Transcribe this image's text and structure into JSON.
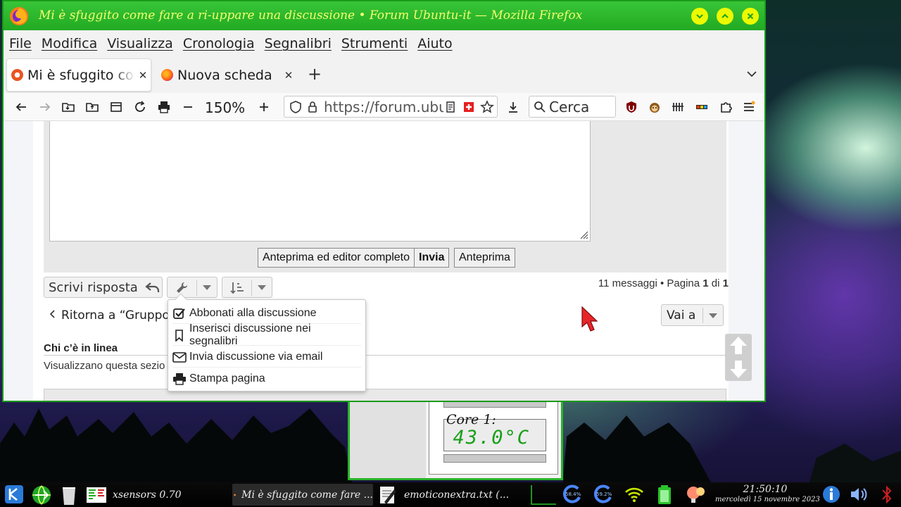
{
  "window": {
    "title": "Mi è sfuggito come fare a ri-uppare una discussione • Forum Ubuntu-it — Mozilla Firefox"
  },
  "menubar": [
    "File",
    "Modifica",
    "Visualizza",
    "Cronologia",
    "Segnalibri",
    "Strumenti",
    "Aiuto"
  ],
  "tabs": [
    {
      "title": "Mi è sfuggito come fare a ri-uppare una discussione",
      "active": true
    },
    {
      "title": "Nuova scheda",
      "active": false
    }
  ],
  "toolbar": {
    "zoom": "150%",
    "url": "https://forum.ubuntu-it.org",
    "search_placeholder": "Cerca"
  },
  "reply_form": {
    "preview_full": "Anteprima ed editor completo",
    "submit": "Invia",
    "preview": "Anteprima"
  },
  "topic_actions": {
    "reply": "Scrivi risposta",
    "pagination_count": "11 messaggi • Pagina",
    "pagination_current": "1",
    "pagination_of": "di",
    "pagination_total": "1",
    "back_link": "Ritorna a “Gruppo F",
    "jump_to": "Vai a"
  },
  "tools_menu": [
    {
      "label": "Abbonati alla discussione",
      "icon": "check-square-icon"
    },
    {
      "label": "Inserisci discussione nei segnalibri",
      "icon": "bookmark-icon"
    },
    {
      "label": "Invia discussione via email",
      "icon": "envelope-icon"
    },
    {
      "label": "Stampa pagina",
      "icon": "print-icon"
    }
  ],
  "online": {
    "heading": "Chi c’è in linea",
    "text": "Visualizzano questa sezio"
  },
  "xsensors": {
    "label": "Core 1:",
    "value": "43.0°C"
  },
  "taskbar": {
    "tasks": [
      {
        "title": "xsensors 0.70"
      },
      {
        "title": "Mi è sfuggito come fare ..."
      },
      {
        "title": "emoticonextra.txt (..."
      }
    ],
    "cpu": [
      "58.4%",
      "59.2%"
    ],
    "clock_time": "21:50:10",
    "clock_date": "mercoledì 15 novembre 2023"
  },
  "colors": {
    "window_border": "#25b325",
    "title_text": "#f2ff6c",
    "title_buttons": "#ecf900",
    "sensor_digits": "#18a018"
  }
}
